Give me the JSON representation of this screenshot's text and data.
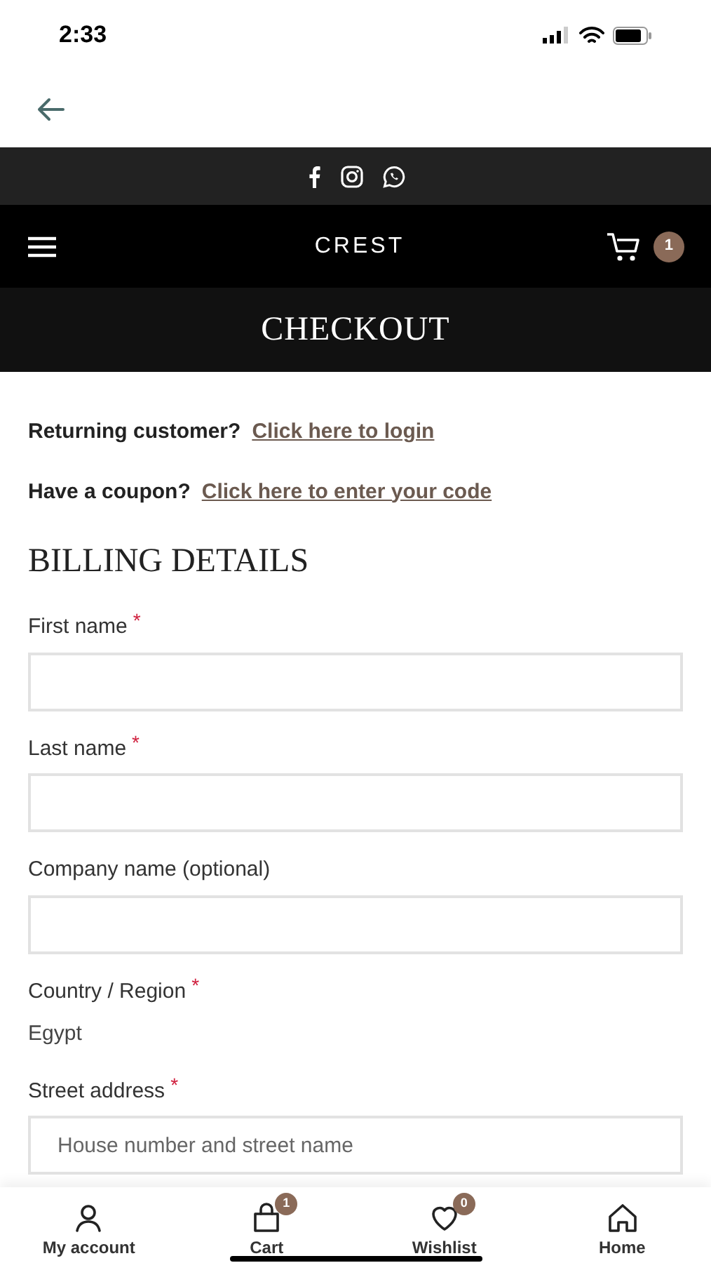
{
  "status_bar": {
    "time": "2:33"
  },
  "header": {
    "logo": "CREST",
    "cart_count": "1"
  },
  "page_title": "CHECKOUT",
  "notices": [
    {
      "prompt": "Returning customer?",
      "link": "Click here to login"
    },
    {
      "prompt": "Have a coupon?",
      "link": "Click here to enter your code"
    }
  ],
  "section_title": "BILLING DETAILS",
  "fields": [
    {
      "kind": "input",
      "label": "First name",
      "required_mark": "*"
    },
    {
      "kind": "input",
      "label": "Last name",
      "required_mark": "*"
    },
    {
      "kind": "input",
      "label": "Company name (optional)"
    },
    {
      "kind": "static",
      "label": "Country / Region",
      "required_mark": "*",
      "value": "Egypt"
    },
    {
      "kind": "input",
      "label": "Street address",
      "required_mark": "*",
      "placeholder": "House number and street name"
    }
  ],
  "bottom_nav": [
    {
      "kind": "account",
      "label": "My account"
    },
    {
      "kind": "cart",
      "label": "Cart",
      "badge": "1"
    },
    {
      "kind": "wishlist",
      "label": "Wishlist",
      "badge": "0"
    },
    {
      "kind": "home",
      "label": "Home"
    }
  ]
}
